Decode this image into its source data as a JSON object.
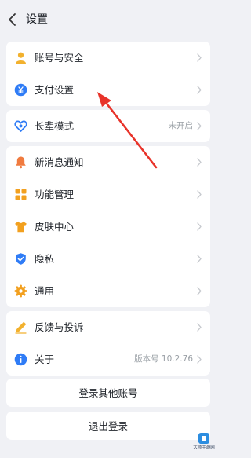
{
  "header": {
    "title": "设置"
  },
  "groups": {
    "account": {
      "items": [
        {
          "label": "账号与安全",
          "icon": "person-icon",
          "color": "#f2b12e"
        },
        {
          "label": "支付设置",
          "icon": "payment-icon",
          "color": "#2f7cf6"
        }
      ]
    },
    "elder": {
      "label": "长辈模式",
      "value": "未开启",
      "icon": "heart-icon",
      "color": "#2f7cf6"
    },
    "features": {
      "items": [
        {
          "label": "新消息通知",
          "icon": "bell-icon",
          "color": "#f07b3f"
        },
        {
          "label": "功能管理",
          "icon": "grid-icon",
          "color": "#f2a01f"
        },
        {
          "label": "皮肤中心",
          "icon": "tshirt-icon",
          "color": "#f2a01f"
        },
        {
          "label": "隐私",
          "icon": "shield-icon",
          "color": "#2f7cf6"
        },
        {
          "label": "通用",
          "icon": "gear-icon",
          "color": "#f2a01f"
        }
      ]
    },
    "about": {
      "items": [
        {
          "label": "反馈与投诉",
          "icon": "pen-icon",
          "color": "#f2b12e"
        },
        {
          "label": "关于",
          "value": "版本号 10.2.76",
          "icon": "info-icon",
          "color": "#2f7cf6"
        }
      ]
    }
  },
  "buttons": {
    "login_other": "登录其他账号",
    "logout": "退出登录"
  },
  "annotation": {
    "arrow_color": "#e8332a"
  },
  "watermark": {
    "text": "大师手游网"
  }
}
